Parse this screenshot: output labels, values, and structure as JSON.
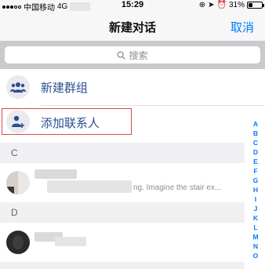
{
  "status_bar": {
    "carrier": "中国移动",
    "network": "4G",
    "time": "15:29",
    "battery": "31%",
    "battery_level": 0.31
  },
  "nav": {
    "title": "新建对话",
    "cancel_label": "取消"
  },
  "search": {
    "placeholder": "搜索"
  },
  "actions": [
    {
      "label": "新建群组",
      "icon": "group-icon"
    },
    {
      "label": "添加联系人",
      "icon": "add-contact-icon"
    }
  ],
  "sections": [
    {
      "letter": "C",
      "preview": "ng. Imagine the stair ex..."
    },
    {
      "letter": "D",
      "preview": ""
    }
  ],
  "index_letters": [
    "A",
    "B",
    "C",
    "D",
    "E",
    "F",
    "G",
    "H",
    "I",
    "J",
    "K",
    "L",
    "M",
    "N",
    "O"
  ],
  "colors": {
    "accent": "#007aff",
    "action_text": "#2b4d8f",
    "highlight": "#d84a4a"
  }
}
